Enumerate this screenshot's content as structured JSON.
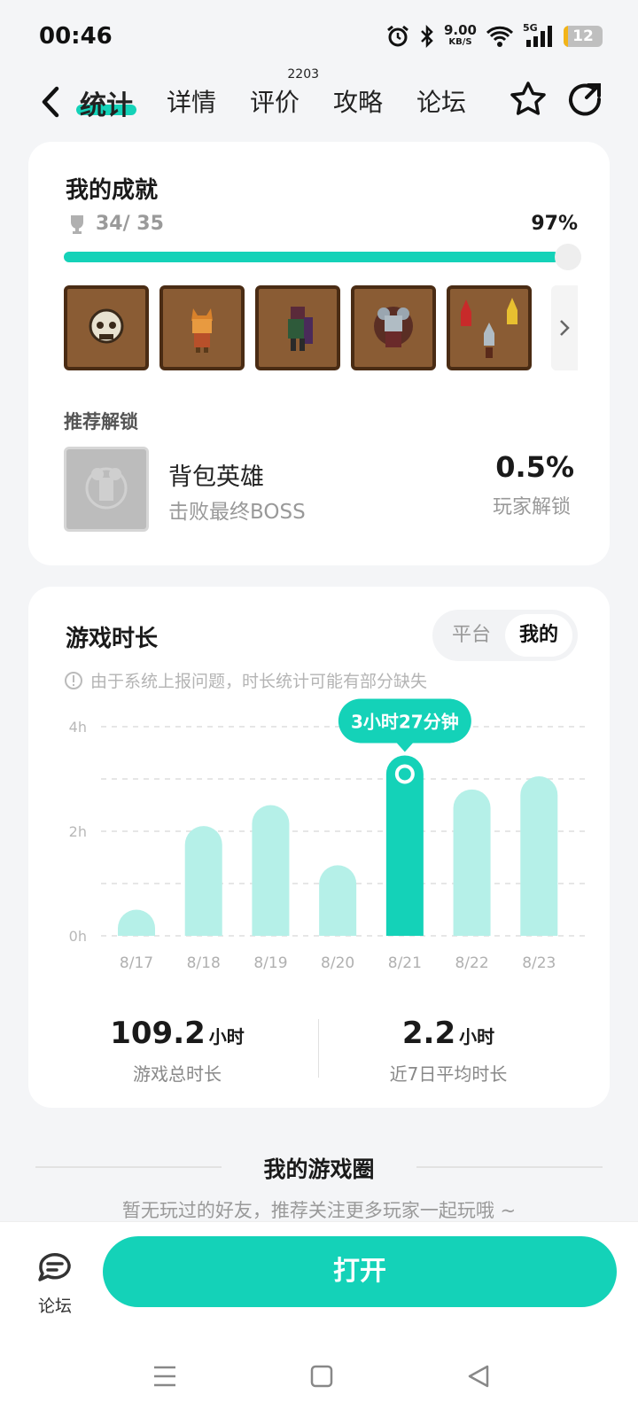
{
  "status_bar": {
    "time": "00:46",
    "net_speed": "9.00",
    "net_unit": "KB/S",
    "signal": "5G",
    "battery": "12",
    "battery_level": 0.12
  },
  "nav": {
    "tabs": [
      {
        "label": "统计",
        "active": true
      },
      {
        "label": "详情"
      },
      {
        "label": "评价",
        "badge": "2203"
      },
      {
        "label": "攻略"
      },
      {
        "label": "论坛"
      }
    ]
  },
  "achievements": {
    "title": "我的成就",
    "count": "34/ 35",
    "percent": "97%",
    "progress": 0.97,
    "badges": [
      "skull-badge",
      "fox-warrior-badge",
      "ranger-badge",
      "mouse-mage-badge",
      "rockets-badge"
    ],
    "recommend_title": "推荐解锁",
    "recommend": {
      "name": "背包英雄",
      "desc": "击败最终BOSS",
      "percent": "0.5%",
      "sub": "玩家解锁"
    }
  },
  "playtime": {
    "title": "游戏时长",
    "toggle": [
      "平台",
      "我的"
    ],
    "toggle_selected": "我的",
    "notice": "由于系统上报问题，时长统计可能有部分缺失",
    "tooltip": "3小时27分钟",
    "total_value": "109.2",
    "total_unit": "小时",
    "total_label": "游戏总时长",
    "avg_value": "2.2",
    "avg_unit": "小时",
    "avg_label": "近7日平均时长"
  },
  "chart_data": {
    "type": "bar",
    "categories": [
      "8/17",
      "8/18",
      "8/19",
      "8/20",
      "8/21",
      "8/22",
      "8/23"
    ],
    "values": [
      0.5,
      2.1,
      2.5,
      1.35,
      3.45,
      2.8,
      3.05
    ],
    "highlight_index": 4,
    "y_ticks": [
      "0h",
      "2h",
      "4h"
    ],
    "ylim": [
      0,
      4
    ],
    "colors": {
      "bar": "#b5f0e8",
      "highlight": "#14d2b8"
    }
  },
  "game_circle": {
    "title": "我的游戏圈",
    "subtitle": "暂无玩过的好友，推荐关注更多玩家一起玩哦 ~"
  },
  "bottom": {
    "forum_label": "论坛",
    "open_label": "打开"
  },
  "colors": {
    "accent": "#14d2b8",
    "bar_light": "#b5f0e8"
  }
}
